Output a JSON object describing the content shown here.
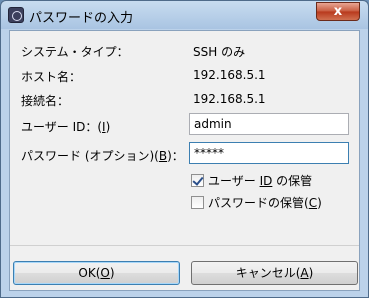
{
  "window": {
    "title": "パスワードの入力",
    "close_label": "x"
  },
  "info": {
    "system_type_label": "システム・タイプ：",
    "system_type_value": "SSH のみ",
    "host_label": "ホスト名：",
    "host_value": "192.168.5.1",
    "connection_label": "接続名：",
    "connection_value": "192.168.5.1"
  },
  "form": {
    "user_id_label": "ユーザー ID：(",
    "user_id_mnemonic": "I",
    "user_id_label_end": ")",
    "user_id_value": "admin",
    "password_label": "パスワード (オプション)(",
    "password_mnemonic": "B",
    "password_label_end": ")：",
    "password_value": "*****"
  },
  "options": {
    "save_user_id_label_a": "ユーザー ",
    "save_user_id_mnemonic": "ID",
    "save_user_id_label_b": " の保管",
    "save_user_id_checked": true,
    "save_password_label_a": "パスワードの保管(",
    "save_password_mnemonic": "C",
    "save_password_label_b": ")",
    "save_password_checked": false
  },
  "buttons": {
    "ok_a": "OK(",
    "ok_mnemonic": "O",
    "ok_b": ")",
    "cancel_a": "キャンセル(",
    "cancel_mnemonic": "A",
    "cancel_b": ")"
  }
}
